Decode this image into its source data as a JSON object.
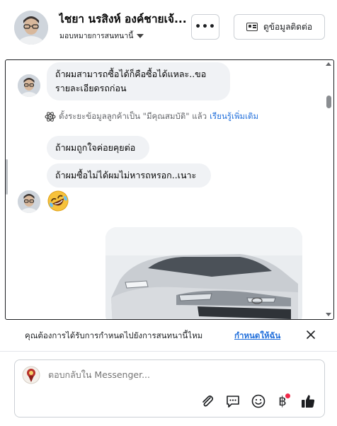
{
  "header": {
    "contact_name": "ไชยา นรสิงห์ องค์ชายเจ้...",
    "assign_label": "มอบหมายการสนทนานี้",
    "more_label": "•••",
    "contact_info_label": "ดูข้อมูลติดต่อ"
  },
  "chat": {
    "messages": [
      {
        "line1": "ถ้าผมสามารถซื้อได้ก็คือซื้อได้แหละ..ขอ",
        "line2": "รายละเอียดรถก่อน"
      },
      {
        "text": "ถ้าผมถูกใจค่อยคุยต่อ"
      },
      {
        "text": "ถ้าผมซื้อไม่ได้ผมไม่หารถหรอก..เนาะ"
      }
    ],
    "system_text": "ตั้งระยะข้อมูลลูกค้าเป็น \"มีคุณสมบัติ\" แล้ว",
    "system_link": "เรียนรู้เพิ่มเติม",
    "emoji": "rolling-on-floor-laughing"
  },
  "notify": {
    "text": "คุณต้องการได้รับการกำหนดไปยังการสนทนานี้ไหม",
    "link": "กำหนดให้ฉัน"
  },
  "composer": {
    "placeholder": "ตอบกลับใน Messenger...",
    "tools": [
      "paperclip-icon",
      "chat-bubble-icon",
      "smiley-icon",
      "baht-icon",
      "thumbs-up-icon"
    ],
    "baht_symbol": "฿"
  },
  "colors": {
    "link": "#216fdb",
    "bubble": "#f0f2f5",
    "notification_dot": "#f02849"
  }
}
